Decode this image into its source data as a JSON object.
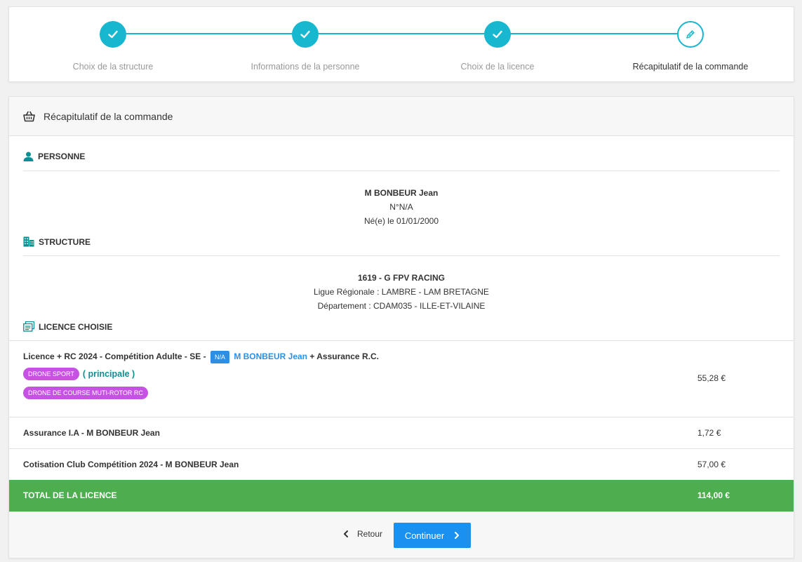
{
  "stepper": {
    "steps": [
      {
        "label": "Choix de la structure",
        "status": "done"
      },
      {
        "label": "Informations de la personne",
        "status": "done"
      },
      {
        "label": "Choix de la licence",
        "status": "done"
      },
      {
        "label": "Récapitulatif de la commande",
        "status": "current"
      }
    ]
  },
  "summary": {
    "header_title": "Récapitulatif de la commande",
    "person": {
      "section_title": "PERSONNE",
      "name": "M BONBEUR Jean",
      "number": "N°N/A",
      "birth": "Né(e) le 01/01/2000"
    },
    "structure": {
      "section_title": "STRUCTURE",
      "name": "1619 - G FPV RACING",
      "league": "Ligue Régionale : LAMBRE - LAM BRETAGNE",
      "department": "Département : CDAM035 - ILLE-ET-VILAINE"
    },
    "license": {
      "section_title": "LICENCE CHOISIE",
      "main_label": "Licence + RC 2024 - Compétition Adulte - SE -",
      "badge": "N/A",
      "person_link": "M BONBEUR Jean",
      "insurance_suffix": "+ Assurance R.C.",
      "tags": [
        "DRONE SPORT",
        "DRONE DE COURSE MUTI-ROTOR RC"
      ],
      "principal_label": "( principale )",
      "main_price": "55,28 €"
    },
    "lines": [
      {
        "label": "Assurance I.A - M BONBEUR Jean",
        "price": "1,72 €"
      },
      {
        "label": "Cotisation Club Compétition 2024 - M BONBEUR Jean",
        "price": "57,00 €"
      }
    ],
    "total": {
      "label": "TOTAL DE LA LICENCE",
      "price": "114,00 €"
    }
  },
  "footer": {
    "back_label": "Retour",
    "continue_label": "Continuer"
  },
  "colors": {
    "accent": "#17b7cf",
    "primary_button": "#1a90ef",
    "total_bar": "#4cae4f",
    "tag": "#c652e3",
    "section_icon": "#0a8f92"
  }
}
